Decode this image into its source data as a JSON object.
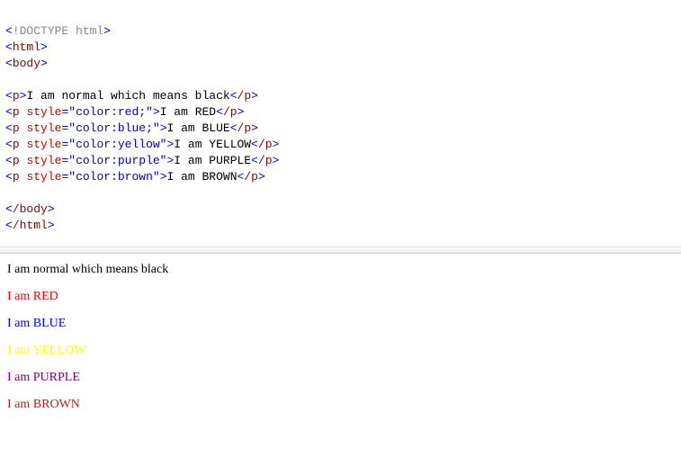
{
  "code": {
    "doctype": "!DOCTYPE html",
    "tag_html": "html",
    "tag_body": "body",
    "tag_p": "p",
    "attr_style": "style",
    "line1_text": "I am normal which means black",
    "line2_val": "\"color:red;\"",
    "line2_text": "I am RED",
    "line3_val": "\"color:blue;\"",
    "line3_text": "I am BLUE",
    "line4_val": "\"color:yellow\"",
    "line4_text": "I am YELLOW",
    "line5_val": "\"color:purple\"",
    "line5_text": "I am PURPLE",
    "line6_val": "\"color:brown\"",
    "line6_text": "I am BROWN"
  },
  "output": {
    "p1": "I am normal which means black",
    "p2": "I am RED",
    "p3": "I am BLUE",
    "p4": "I am YELLOW",
    "p5": "I am PURPLE",
    "p6": "I am BROWN"
  }
}
